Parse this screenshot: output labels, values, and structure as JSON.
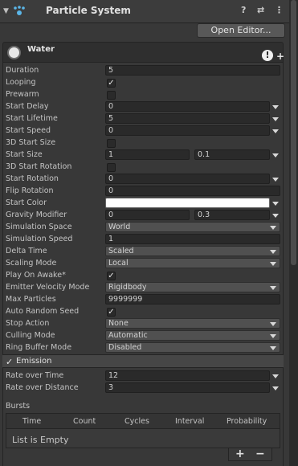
{
  "header": {
    "title": "Particle System",
    "help_glyph": "?",
    "presets_glyph": "⇄",
    "menu_glyph": "⋮",
    "icons": [
      "chevron-down-icon",
      "particle-system-icon",
      "help-icon",
      "presets-icon",
      "menu-icon"
    ]
  },
  "open_editor_label": "Open Editor...",
  "module": {
    "name": "Water",
    "info_glyph": "!",
    "add_glyph": "+"
  },
  "properties": [
    {
      "label": "Duration",
      "type": "text",
      "value": "5"
    },
    {
      "label": "Looping",
      "type": "check",
      "checked": true
    },
    {
      "label": "Prewarm",
      "type": "check",
      "checked": false
    },
    {
      "label": "Start Delay",
      "type": "curve",
      "value": "0"
    },
    {
      "label": "Start Lifetime",
      "type": "curve",
      "value": "5"
    },
    {
      "label": "Start Speed",
      "type": "curve",
      "value": "0"
    },
    {
      "label": "3D Start Size",
      "type": "check",
      "checked": false
    },
    {
      "label": "Start Size",
      "type": "range",
      "value": "1",
      "value2": "0.1"
    },
    {
      "label": "3D Start Rotation",
      "type": "check",
      "checked": false
    },
    {
      "label": "Start Rotation",
      "type": "curve",
      "value": "0"
    },
    {
      "label": "Flip Rotation",
      "type": "text",
      "value": "0"
    },
    {
      "label": "Start Color",
      "type": "color",
      "value": "#ffffff"
    },
    {
      "label": "Gravity Modifier",
      "type": "range",
      "value": "0",
      "value2": "0.3"
    },
    {
      "label": "Simulation Space",
      "type": "dropdown",
      "value": "World"
    },
    {
      "label": "Simulation Speed",
      "type": "text",
      "value": "1"
    },
    {
      "label": "Delta Time",
      "type": "dropdown",
      "value": "Scaled"
    },
    {
      "label": "Scaling Mode",
      "type": "dropdown",
      "value": "Local"
    },
    {
      "label": "Play On Awake*",
      "type": "check",
      "checked": true
    },
    {
      "label": "Emitter Velocity Mode",
      "type": "dropdown",
      "value": "Rigidbody"
    },
    {
      "label": "Max Particles",
      "type": "text",
      "value": "9999999"
    },
    {
      "label": "Auto Random Seed",
      "type": "check",
      "checked": true
    },
    {
      "label": "Stop Action",
      "type": "dropdown",
      "value": "None"
    },
    {
      "label": "Culling Mode",
      "type": "dropdown",
      "value": "Automatic"
    },
    {
      "label": "Ring Buffer Mode",
      "type": "dropdown",
      "value": "Disabled"
    }
  ],
  "emission": {
    "title": "Emission",
    "enabled": true,
    "rows": [
      {
        "label": "Rate over Time",
        "value": "12"
      },
      {
        "label": "Rate over Distance",
        "value": "3"
      }
    ],
    "bursts": {
      "label": "Bursts",
      "columns": [
        "Time",
        "Count",
        "Cycles",
        "Interval",
        "Probability"
      ],
      "empty_text": "List is Empty",
      "add_glyph": "+",
      "remove_glyph": "−"
    }
  },
  "check_glyph": "✓",
  "colors": {
    "background": "#383838",
    "field": "#2a2a2a",
    "dropdown": "#505050",
    "text": "#c4c4c4"
  }
}
